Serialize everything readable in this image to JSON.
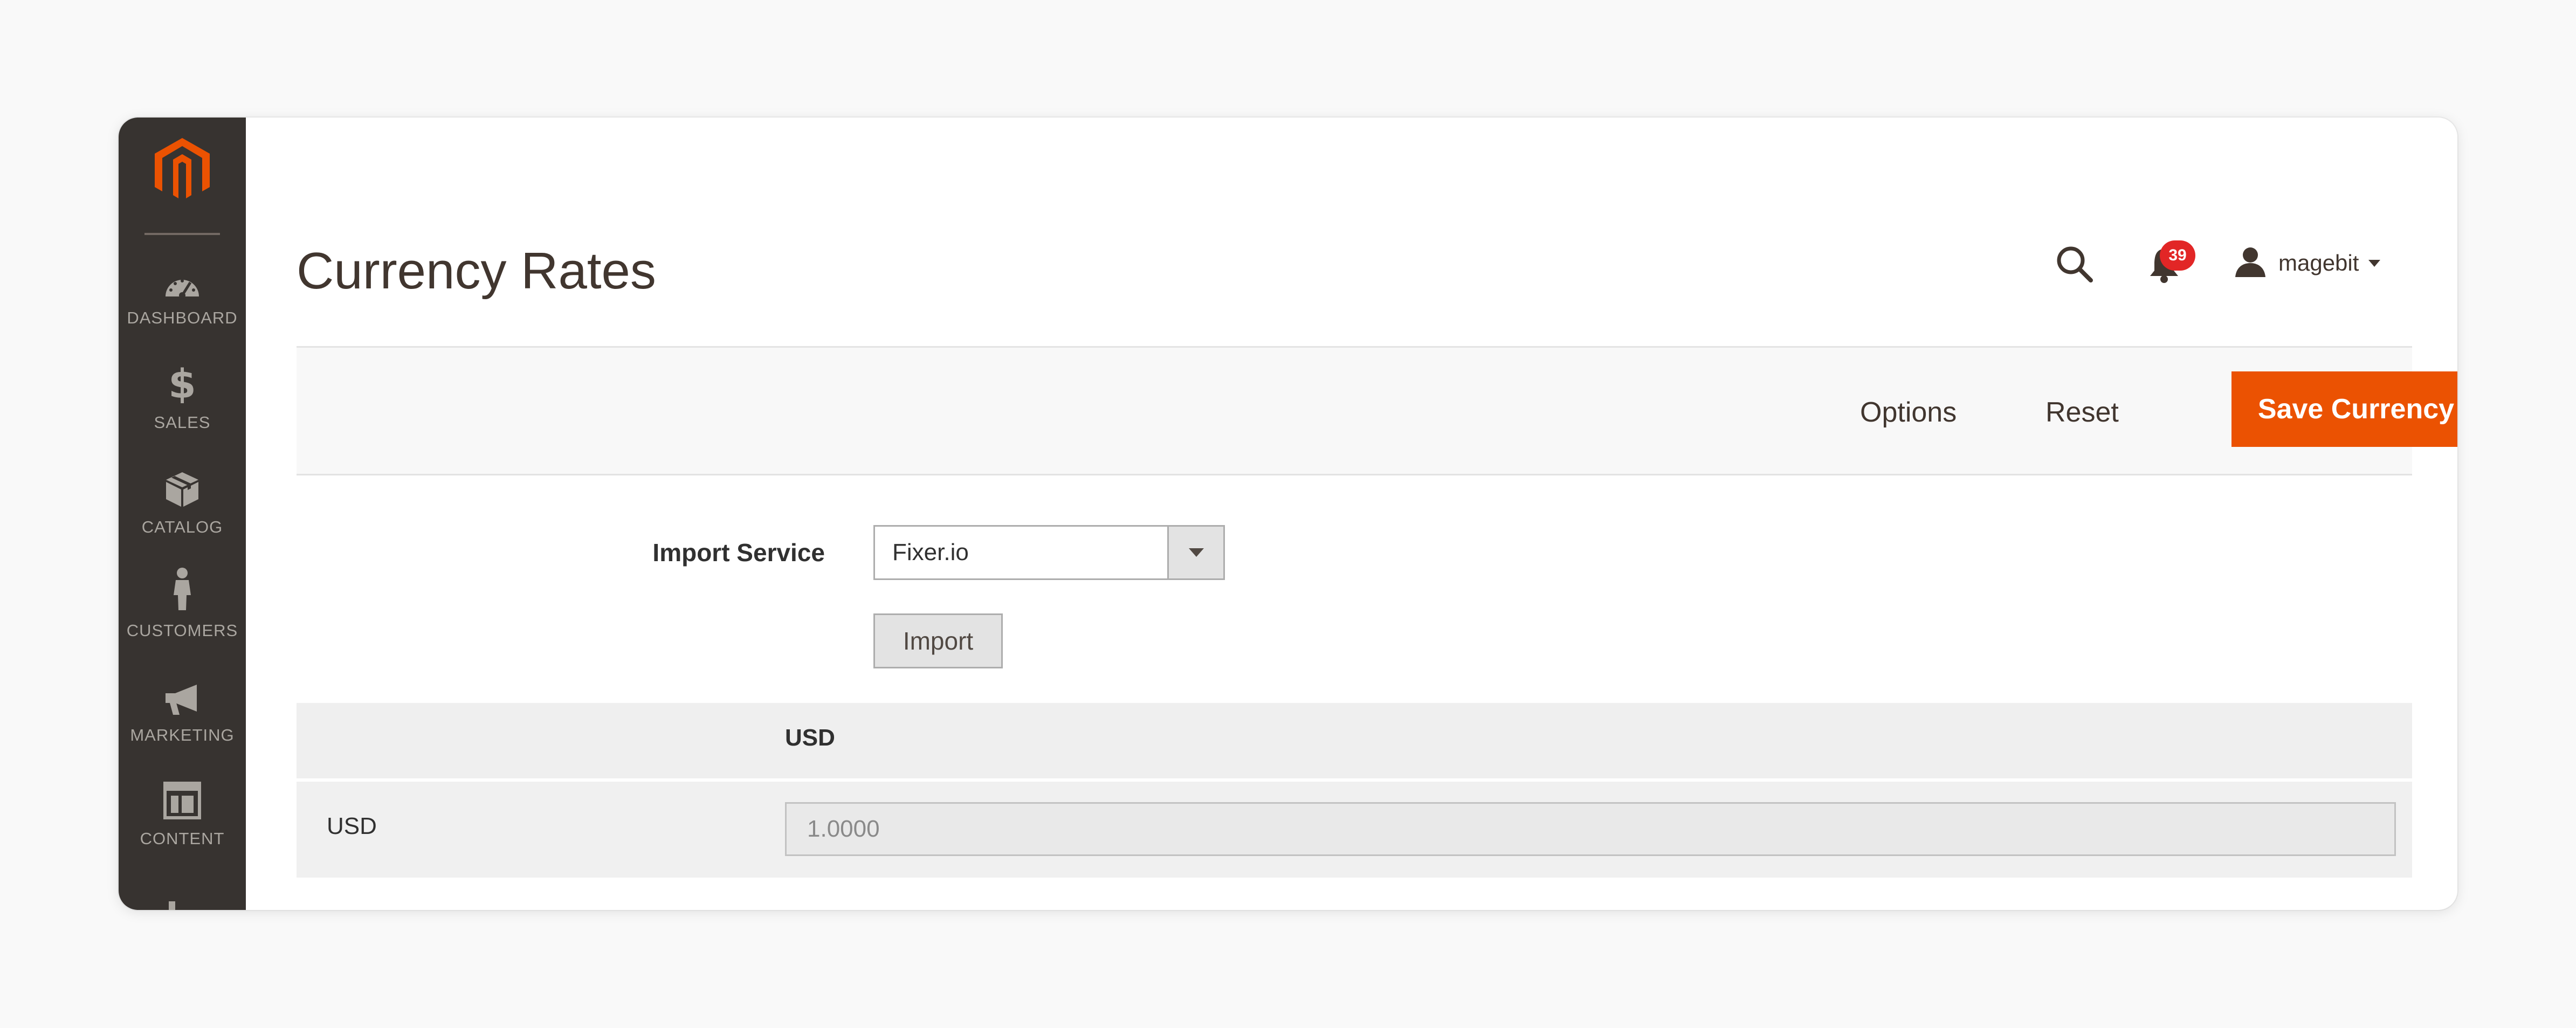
{
  "sidebar": {
    "logo": "magento-logo",
    "items": [
      {
        "label": "DASHBOARD",
        "icon": "dashboard-icon"
      },
      {
        "label": "SALES",
        "icon": "dollar-icon"
      },
      {
        "label": "CATALOG",
        "icon": "box-icon"
      },
      {
        "label": "CUSTOMERS",
        "icon": "person-icon"
      },
      {
        "label": "MARKETING",
        "icon": "megaphone-icon"
      },
      {
        "label": "CONTENT",
        "icon": "layout-icon"
      },
      {
        "label": "",
        "icon": "bar-chart-icon"
      }
    ]
  },
  "header": {
    "title": "Currency Rates",
    "notification_count": "39",
    "username": "magebit"
  },
  "actions": {
    "options_label": "Options",
    "reset_label": "Reset",
    "save_label": "Save Currency Rates"
  },
  "import": {
    "label": "Import Service",
    "selected_service": "Fixer.io",
    "button_label": "Import"
  },
  "rates_table": {
    "column_headers": [
      "USD"
    ],
    "rows": [
      {
        "currency": "USD",
        "rates": [
          "1.0000"
        ]
      }
    ]
  },
  "colors": {
    "sidebar_bg": "#373330",
    "accent": "#eb5202",
    "badge": "#e22626",
    "title_text": "#41362f"
  }
}
